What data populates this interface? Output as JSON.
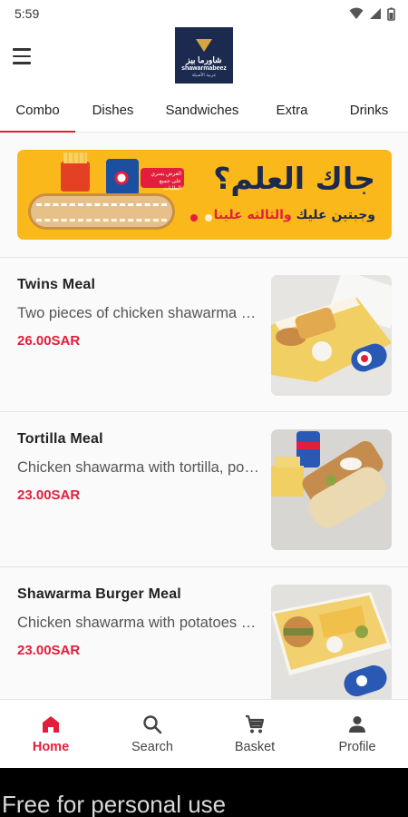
{
  "status_bar": {
    "time": "5:59",
    "icons": [
      "wifi-icon",
      "signal-icon",
      "battery-icon"
    ]
  },
  "app_bar": {
    "menu_icon": "hamburger-menu-icon",
    "logo": {
      "arabic": "شاورما بيز",
      "english": "shawarmabeez",
      "tagline": "عربية الأصيلة"
    }
  },
  "tabs": [
    {
      "label": "Combo",
      "active": true
    },
    {
      "label": "Dishes",
      "active": false
    },
    {
      "label": "Sandwiches",
      "active": false
    },
    {
      "label": "Extra",
      "active": false
    },
    {
      "label": "Drinks",
      "active": false
    }
  ],
  "banner": {
    "headline": "جاك العلم؟",
    "subline_part1": "وجبتين عليك",
    "subline_part2": "والثالثه علينا",
    "tag": "العرض يسري على جميع الطلبات",
    "dots": 2,
    "active_dot": 0
  },
  "products": [
    {
      "name": "Twins Meal",
      "description": "Two pieces of chicken shawarma with potatoes and a drink",
      "price": "26.00SAR"
    },
    {
      "name": "Tortilla Meal",
      "description": "Chicken shawarma with tortilla, potatoes and a drink",
      "price": "23.00SAR"
    },
    {
      "name": "Shawarma Burger Meal",
      "description": "Chicken shawarma with potatoes and a drink",
      "price": "23.00SAR"
    }
  ],
  "bottom_nav": [
    {
      "label": "Home",
      "icon": "home-icon",
      "active": true
    },
    {
      "label": "Search",
      "icon": "search-icon",
      "active": false
    },
    {
      "label": "Basket",
      "icon": "cart-icon",
      "active": false
    },
    {
      "label": "Profile",
      "icon": "person-icon",
      "active": false
    }
  ],
  "watermark": "Free for personal use",
  "colors": {
    "accent": "#e31e3c",
    "banner": "#fbb81b",
    "brand_navy": "#1c2a4f"
  }
}
